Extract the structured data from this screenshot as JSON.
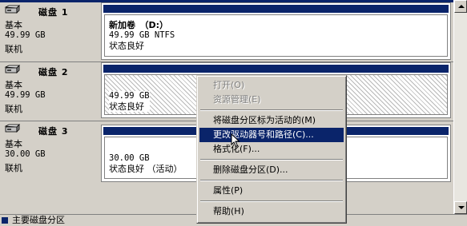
{
  "disks": [
    {
      "name": "磁盘 1",
      "type": "基本",
      "size": "49.99 GB",
      "status": "联机",
      "volume": {
        "label": "新加卷　（D:）",
        "size_fs": "49.99 GB NTFS",
        "status": "状态良好"
      }
    },
    {
      "name": "磁盘 2",
      "type": "基本",
      "size": "49.99 GB",
      "status": "联机",
      "volume": {
        "label": "",
        "size_fs": "49.99 GB",
        "status": "状态良好"
      }
    },
    {
      "name": "磁盘 3",
      "type": "基本",
      "size": "30.00 GB",
      "status": "联机",
      "volume": {
        "label": "",
        "size_fs": "30.00 GB",
        "status": "状态良好 （活动）"
      }
    }
  ],
  "context_menu": {
    "open": "打开(O)",
    "explore": "资源管理(E)",
    "mark_active": "将磁盘分区标为活动的(M)",
    "change_drive_letter": "更改驱动器号和路径(C)...",
    "format": "格式化(F)...",
    "delete_partition": "删除磁盘分区(D)...",
    "properties": "属性(P)",
    "help": "帮助(H)"
  },
  "legend": {
    "primary_partition": "主要磁盘分区"
  },
  "colors": {
    "volume_bar": "#0a246a",
    "highlight": "#0a246a",
    "background": "#d4d0c8"
  },
  "icons": {
    "disk": "disk-drive-icon",
    "cursor": "mouse-pointer-icon"
  }
}
